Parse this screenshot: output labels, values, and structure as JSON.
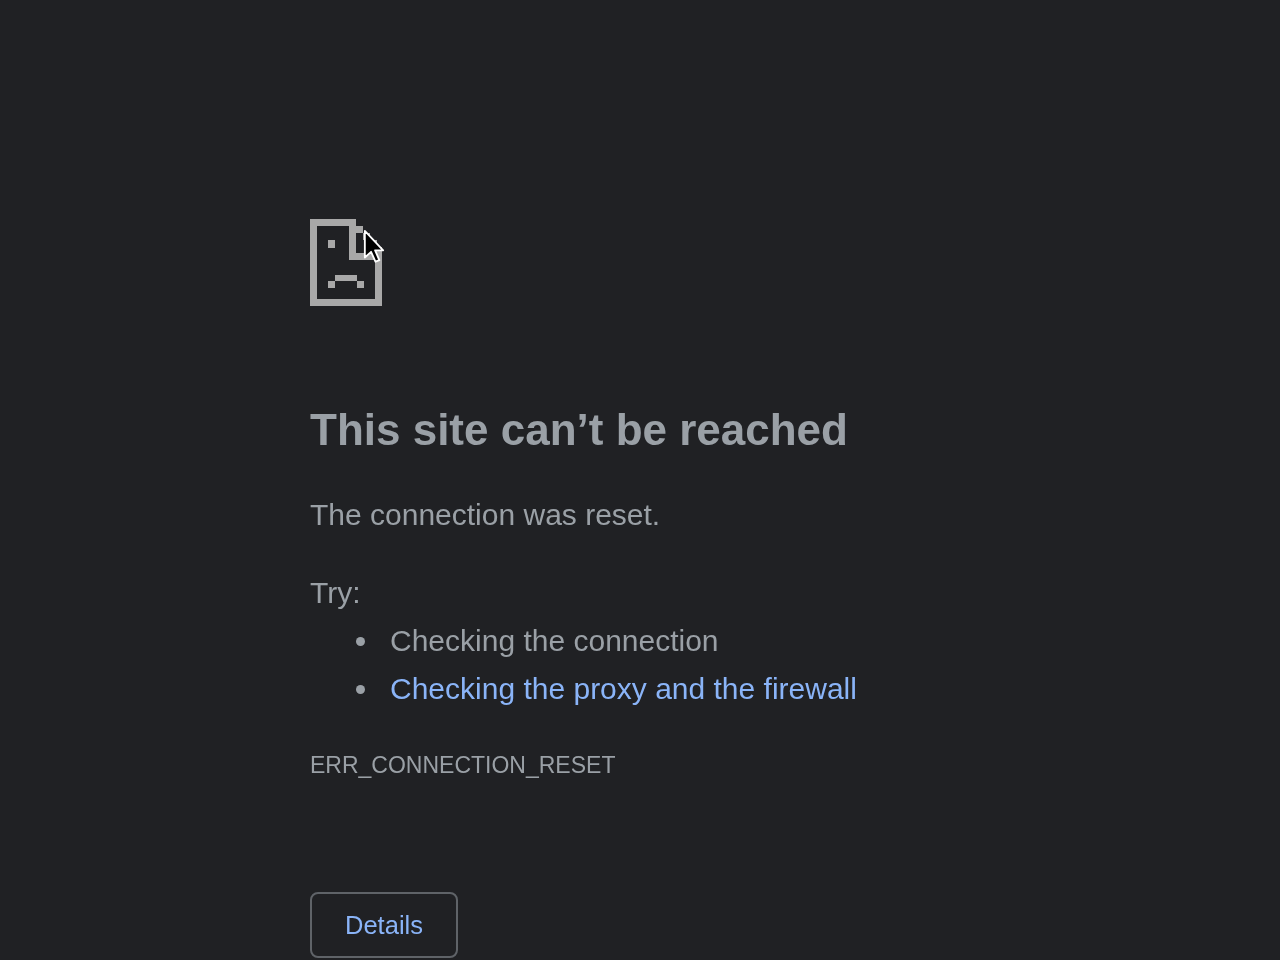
{
  "error_page": {
    "heading": "This site can’t be reached",
    "message": "The connection was reset.",
    "suggestions_label": "Try:",
    "suggestions": [
      {
        "kind": "text",
        "text": "Checking the connection"
      },
      {
        "kind": "link",
        "text": "Checking the proxy and the firewall"
      }
    ],
    "error_code": "ERR_CONNECTION_RESET",
    "buttons": [
      {
        "label": "Details"
      }
    ]
  }
}
